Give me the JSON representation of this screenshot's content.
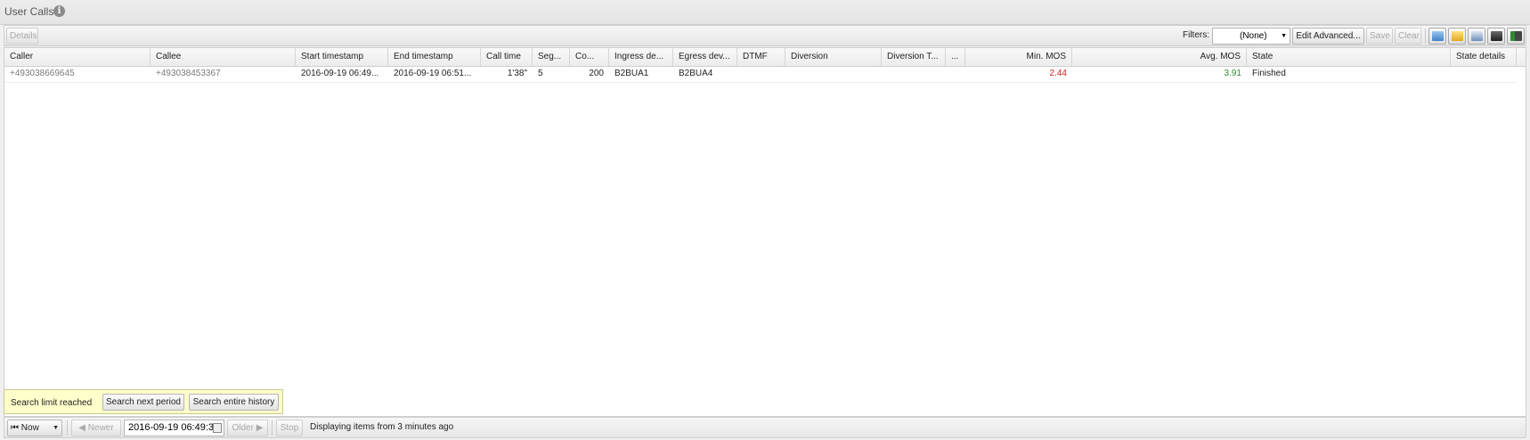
{
  "panel": {
    "title": "User Calls",
    "info_icon": "info-icon"
  },
  "toolbar": {
    "details_label": "Details",
    "filters_label": "Filters:",
    "filter_value": "(None)",
    "edit_advanced_label": "Edit Advanced...",
    "save_label": "Save",
    "clear_label": "Clear",
    "icons": [
      "refresh-icon",
      "open-folder-icon",
      "export-icon",
      "save-disk-icon",
      "columns-icon"
    ]
  },
  "table": {
    "columns": [
      "Caller",
      "Callee",
      "Start timestamp",
      "End timestamp",
      "Call time",
      "Seg...",
      "Co...",
      "Ingress de...",
      "Egress dev...",
      "DTMF",
      "Diversion",
      "Diversion T...",
      "...",
      "Min. MOS",
      "Avg. MOS",
      "State",
      "State details"
    ],
    "rows": [
      {
        "caller": "+493038669645",
        "callee": "+493038453367",
        "start": "2016-09-19 06:49...",
        "end": "2016-09-19 06:51...",
        "call_time": "1'38\"",
        "segments": "5",
        "code": "200",
        "ingress": "B2BUA1",
        "egress": "B2BUA4",
        "dtmf": "",
        "diversion": "",
        "diversion_type": "",
        "extra": "",
        "min_mos": "2.44",
        "avg_mos": "3.91",
        "state": "Finished",
        "state_details": ""
      }
    ]
  },
  "search_limit": {
    "message": "Search limit reached",
    "next_period_label": "Search next period",
    "entire_history_label": "Search entire history"
  },
  "pager": {
    "now_label": "Now",
    "newer_label": "Newer",
    "date_value": "2016-09-19 06:49:30",
    "older_label": "Older",
    "stop_label": "Stop",
    "status": "Displaying items from 3 minutes ago"
  },
  "colors": {
    "min_mos": "#d21e1e",
    "avg_mos": "#2e8b2e",
    "limit_bg": "#ffffcc"
  }
}
